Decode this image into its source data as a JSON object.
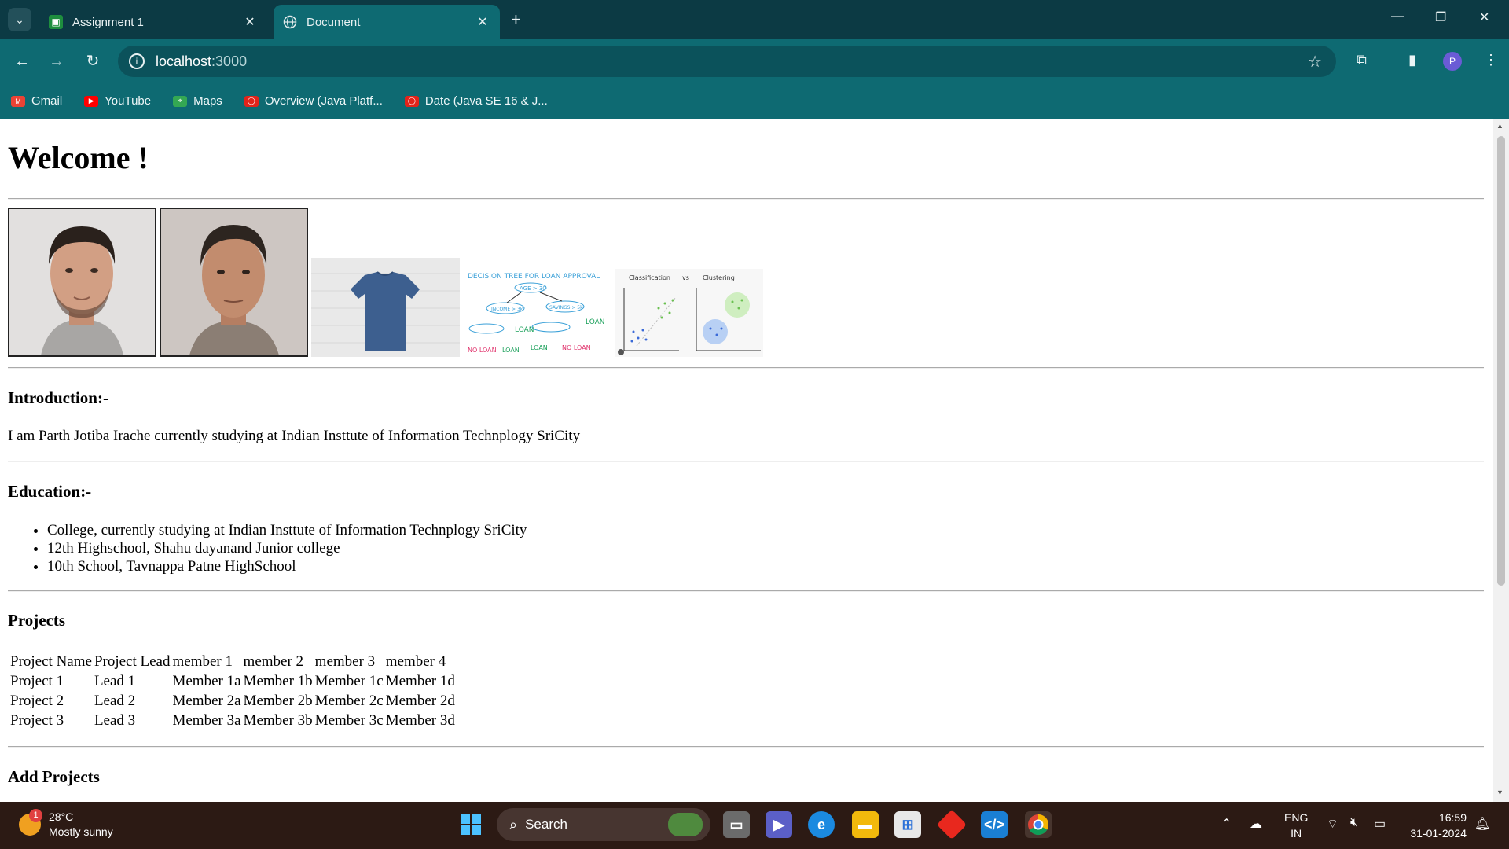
{
  "browser": {
    "tabs": [
      {
        "title": "Assignment 1",
        "active": false,
        "icon": "classroom-icon"
      },
      {
        "title": "Document",
        "active": true,
        "icon": "globe-icon"
      }
    ],
    "tab_close_glyph": "✕",
    "new_tab_glyph": "+",
    "url_host": "localhost",
    "url_port": ":3000",
    "bookmarks": [
      {
        "label": "Gmail",
        "icon": "gmail-icon",
        "color": "#ea4335"
      },
      {
        "label": "YouTube",
        "icon": "youtube-icon",
        "color": "#ff0000"
      },
      {
        "label": "Maps",
        "icon": "maps-icon",
        "color": "#34a853"
      },
      {
        "label": "Overview (Java Platf...",
        "icon": "oracle-icon",
        "color": "#e2231a"
      },
      {
        "label": "Date (Java SE 16 & J...",
        "icon": "oracle-icon",
        "color": "#e2231a"
      }
    ],
    "profile_initial": "P"
  },
  "page": {
    "heading": "Welcome !",
    "images": [
      {
        "name": "portrait-photo-1",
        "kind": "portrait"
      },
      {
        "name": "portrait-photo-2",
        "kind": "portrait"
      },
      {
        "name": "tshirt-photo",
        "kind": "product"
      },
      {
        "name": "decision-tree-image",
        "kind": "diagram"
      },
      {
        "name": "classification-clustering-image",
        "kind": "diagram"
      }
    ],
    "diagram_text": {
      "decision_title": "DECISION TREE FOR LOAN APPROVAL",
      "decision_age": "AGE > 30",
      "decision_income": "INCOME > 3k",
      "decision_savings": "SAVINGS > 5k",
      "decision_loan": "LOAN",
      "decision_noloan": "NO LOAN",
      "cc_classification": "Classification",
      "cc_vs": "vs",
      "cc_clustering": "Clustering"
    },
    "introduction": {
      "heading": "Introduction:-",
      "text": "I am Parth Jotiba Irache currently studying at Indian Insttute of Information Technplogy SriCity"
    },
    "education": {
      "heading": "Education:-",
      "items": [
        "College, currently studying at Indian Insttute of Information Technplogy SriCity",
        "12th Highschool, Shahu dayanand Junior college",
        "10th School, Tavnappa Patne HighSchool"
      ]
    },
    "projects": {
      "heading": "Projects",
      "columns": [
        "Project Name",
        "Project Lead",
        "member 1",
        "member 2",
        "member 3",
        "member 4"
      ],
      "rows": [
        [
          "Project 1",
          "Lead 1",
          "Member 1a",
          "Member 1b",
          "Member 1c",
          "Member 1d"
        ],
        [
          "Project 2",
          "Lead 2",
          "Member 2a",
          "Member 2b",
          "Member 2c",
          "Member 2d"
        ],
        [
          "Project 3",
          "Lead 3",
          "Member 3a",
          "Member 3b",
          "Member 3c",
          "Member 3d"
        ]
      ]
    },
    "add_projects_heading": "Add Projects"
  },
  "taskbar": {
    "weather_temp": "28°C",
    "weather_desc": "Mostly sunny",
    "weather_badge": "1",
    "search_label": "Search",
    "lang_top": "ENG",
    "lang_bottom": "IN",
    "time": "16:59",
    "date": "31-01-2024"
  },
  "colors": {
    "tab_strip": "#0c3a44",
    "toolbar": "#0e6a72",
    "taskbar": "#2c1a14"
  }
}
